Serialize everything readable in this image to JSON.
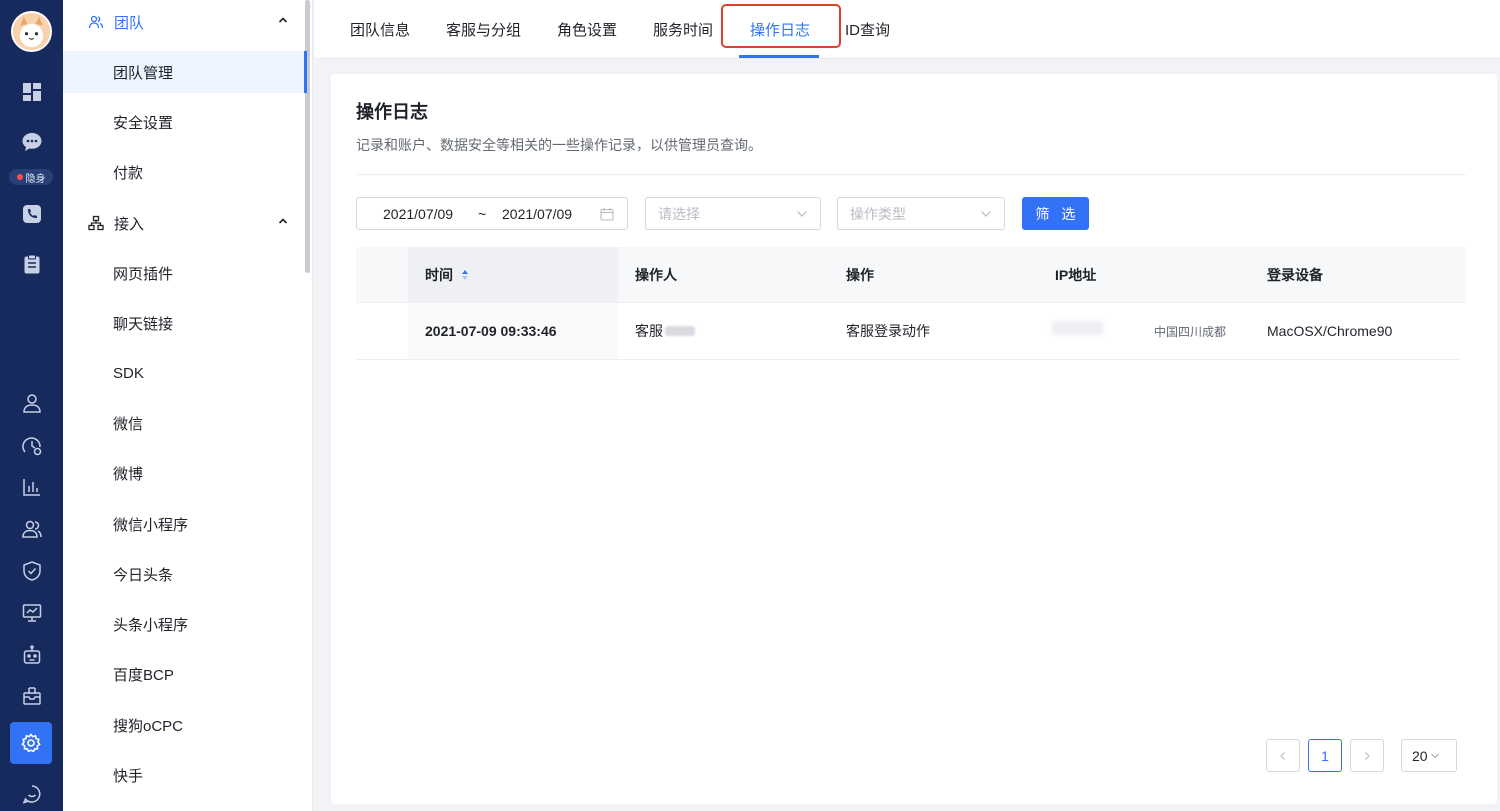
{
  "rail": {
    "status_badge": "隐身",
    "icons": [
      "dashboard-icon",
      "chat-icon",
      "phone-icon",
      "clipboard-icon",
      "user-icon",
      "clock-history-icon",
      "bar-chart-icon",
      "team-icon",
      "shield-icon",
      "monitor-icon",
      "robot-icon",
      "mail-box-icon",
      "settings-icon",
      "message-icon"
    ]
  },
  "sidebar": {
    "groups": [
      {
        "label": "团队",
        "icon": "team-icon"
      },
      {
        "label": "接入",
        "icon": "network-icon"
      }
    ],
    "team_items": [
      "团队管理",
      "安全设置",
      "付款"
    ],
    "access_items": [
      "网页插件",
      "聊天链接",
      "SDK",
      "微信",
      "微博",
      "微信小程序",
      "今日头条",
      "头条小程序",
      "百度BCP",
      "搜狗oCPC",
      "快手"
    ]
  },
  "tabs": [
    {
      "label": "团队信息"
    },
    {
      "label": "客服与分组"
    },
    {
      "label": "角色设置"
    },
    {
      "label": "服务时间"
    },
    {
      "label": "操作日志"
    },
    {
      "label": "ID查询"
    }
  ],
  "page": {
    "title": "操作日志",
    "description": "记录和账户、数据安全等相关的一些操作记录，以供管理员查询。"
  },
  "filters": {
    "date_start": "2021/07/09",
    "date_sep": "~",
    "date_end": "2021/07/09",
    "operator_placeholder": "请选择",
    "type_placeholder": "操作类型",
    "filter_button": "筛 选"
  },
  "table": {
    "columns": [
      "时间",
      "操作人",
      "操作",
      "IP地址",
      "登录设备"
    ],
    "rows": [
      {
        "time": "2021-07-09 09:33:46",
        "operator": "客服",
        "action": "客服登录动作",
        "location": "中国四川成都",
        "device": "MacOSX/Chrome90"
      }
    ]
  },
  "pagination": {
    "current_page": "1",
    "page_size": "20"
  },
  "colors": {
    "rail_bg": "#162a5e",
    "accent": "#3273f6",
    "highlight": "#e0412f"
  }
}
